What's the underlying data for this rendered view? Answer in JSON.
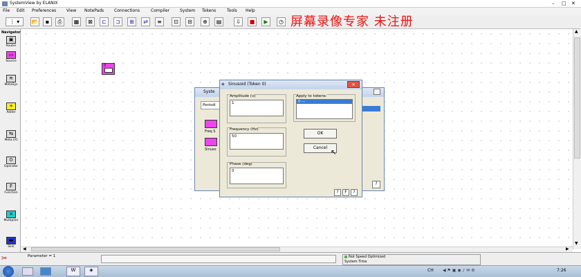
{
  "app": {
    "title": "SystemView by ELANIX"
  },
  "menu": [
    "File",
    "Edit",
    "Preferences",
    "View",
    "NotePads",
    "Connections",
    "Compiler",
    "System",
    "Tokens",
    "Tools",
    "Help"
  ],
  "watermark": "屏幕录像专家  未注册",
  "palette": {
    "header": "Navigator",
    "items": [
      {
        "label": "Router",
        "glyph": "▣",
        "color": "#dddddd"
      },
      {
        "label": "Source",
        "glyph": "▭",
        "color": "#ee44ee"
      },
      {
        "label": "MetaSys",
        "glyph": "≋",
        "color": "#dddddd"
      },
      {
        "label": "Adder",
        "glyph": "+",
        "color": "#ffee22"
      },
      {
        "label": "Meta I/O",
        "glyph": "⇆",
        "color": "#dddddd"
      },
      {
        "label": "Operator",
        "glyph": "0",
        "color": "#dddddd"
      },
      {
        "label": "Function",
        "glyph": "F",
        "color": "#dddddd"
      },
      {
        "label": "Multiplier",
        "glyph": "×",
        "color": "#22cccc"
      },
      {
        "label": "Sink",
        "glyph": "▬",
        "color": "#2233cc"
      }
    ]
  },
  "canvas_token": {
    "label": "0"
  },
  "back_dialog": {
    "title": "Syste",
    "tab": "Periodi",
    "item1": "Freq S",
    "item2": "Sinuso",
    "help": "?"
  },
  "dialog": {
    "title": "Sinusoid (Token 0)",
    "amplitude": {
      "label": "Amplitude (v)",
      "value": "1"
    },
    "frequency": {
      "label": "Frequency (Hz)",
      "value": "50"
    },
    "phase": {
      "label": "Phase (deg)",
      "value": "0"
    },
    "apply": {
      "label": "Apply to tokens:",
      "items": [
        "0 ---"
      ]
    },
    "ok_label": "OK",
    "cancel_label": "Cancel",
    "help_buttons": [
      "?",
      "F",
      "?"
    ]
  },
  "status": {
    "parameter": "Parameter = 1",
    "speed": "Not Speed Optimized",
    "system_time": "System Time"
  },
  "taskbar": {
    "clock": "7:26",
    "lang": "CH"
  }
}
